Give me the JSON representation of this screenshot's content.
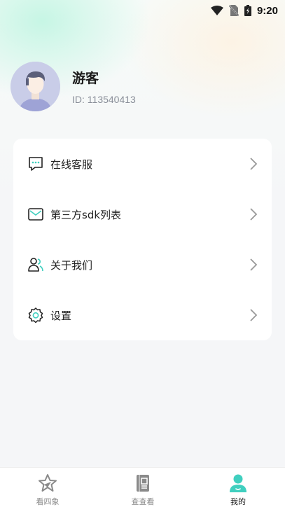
{
  "status_bar": {
    "time": "9:20"
  },
  "profile": {
    "nickname": "游客",
    "user_id": "ID: 113540413"
  },
  "menu": {
    "items": [
      {
        "label": "在线客服",
        "icon": "chat-bubble-icon"
      },
      {
        "label": "第三方sdk列表",
        "icon": "mail-icon"
      },
      {
        "label": "关于我们",
        "icon": "users-icon"
      },
      {
        "label": "设置",
        "icon": "gear-icon"
      }
    ]
  },
  "tabbar": {
    "tabs": [
      {
        "label": "看四象",
        "icon": "star-icon",
        "active": false
      },
      {
        "label": "查查看",
        "icon": "book-icon",
        "active": false
      },
      {
        "label": "我的",
        "icon": "profile-icon",
        "active": true
      }
    ],
    "accent_color": "#3fcfbf"
  }
}
